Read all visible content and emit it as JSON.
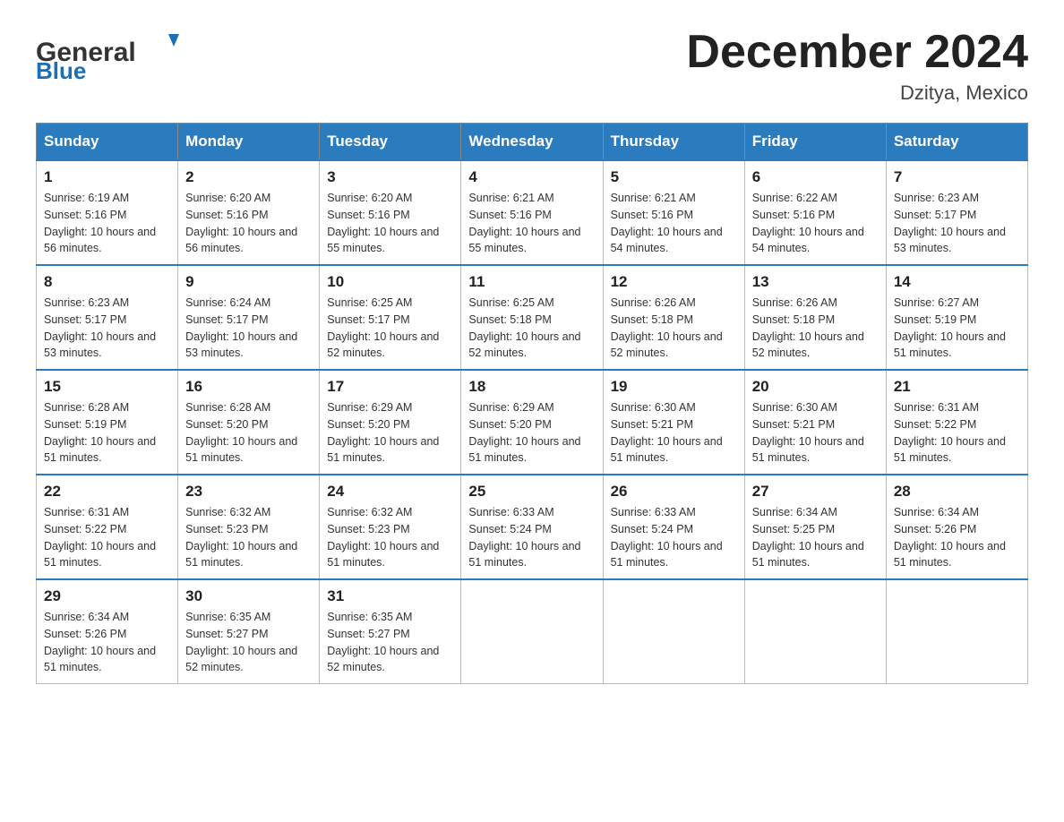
{
  "header": {
    "logo": {
      "text_general": "General",
      "text_blue": "Blue",
      "triangle_color": "#1a6fb5"
    },
    "title": "December 2024",
    "subtitle": "Dzitya, Mexico"
  },
  "days_of_week": [
    "Sunday",
    "Monday",
    "Tuesday",
    "Wednesday",
    "Thursday",
    "Friday",
    "Saturday"
  ],
  "weeks": [
    [
      {
        "day": 1,
        "sunrise": "6:19 AM",
        "sunset": "5:16 PM",
        "daylight": "10 hours and 56 minutes."
      },
      {
        "day": 2,
        "sunrise": "6:20 AM",
        "sunset": "5:16 PM",
        "daylight": "10 hours and 56 minutes."
      },
      {
        "day": 3,
        "sunrise": "6:20 AM",
        "sunset": "5:16 PM",
        "daylight": "10 hours and 55 minutes."
      },
      {
        "day": 4,
        "sunrise": "6:21 AM",
        "sunset": "5:16 PM",
        "daylight": "10 hours and 55 minutes."
      },
      {
        "day": 5,
        "sunrise": "6:21 AM",
        "sunset": "5:16 PM",
        "daylight": "10 hours and 54 minutes."
      },
      {
        "day": 6,
        "sunrise": "6:22 AM",
        "sunset": "5:16 PM",
        "daylight": "10 hours and 54 minutes."
      },
      {
        "day": 7,
        "sunrise": "6:23 AM",
        "sunset": "5:17 PM",
        "daylight": "10 hours and 53 minutes."
      }
    ],
    [
      {
        "day": 8,
        "sunrise": "6:23 AM",
        "sunset": "5:17 PM",
        "daylight": "10 hours and 53 minutes."
      },
      {
        "day": 9,
        "sunrise": "6:24 AM",
        "sunset": "5:17 PM",
        "daylight": "10 hours and 53 minutes."
      },
      {
        "day": 10,
        "sunrise": "6:25 AM",
        "sunset": "5:17 PM",
        "daylight": "10 hours and 52 minutes."
      },
      {
        "day": 11,
        "sunrise": "6:25 AM",
        "sunset": "5:18 PM",
        "daylight": "10 hours and 52 minutes."
      },
      {
        "day": 12,
        "sunrise": "6:26 AM",
        "sunset": "5:18 PM",
        "daylight": "10 hours and 52 minutes."
      },
      {
        "day": 13,
        "sunrise": "6:26 AM",
        "sunset": "5:18 PM",
        "daylight": "10 hours and 52 minutes."
      },
      {
        "day": 14,
        "sunrise": "6:27 AM",
        "sunset": "5:19 PM",
        "daylight": "10 hours and 51 minutes."
      }
    ],
    [
      {
        "day": 15,
        "sunrise": "6:28 AM",
        "sunset": "5:19 PM",
        "daylight": "10 hours and 51 minutes."
      },
      {
        "day": 16,
        "sunrise": "6:28 AM",
        "sunset": "5:20 PM",
        "daylight": "10 hours and 51 minutes."
      },
      {
        "day": 17,
        "sunrise": "6:29 AM",
        "sunset": "5:20 PM",
        "daylight": "10 hours and 51 minutes."
      },
      {
        "day": 18,
        "sunrise": "6:29 AM",
        "sunset": "5:20 PM",
        "daylight": "10 hours and 51 minutes."
      },
      {
        "day": 19,
        "sunrise": "6:30 AM",
        "sunset": "5:21 PM",
        "daylight": "10 hours and 51 minutes."
      },
      {
        "day": 20,
        "sunrise": "6:30 AM",
        "sunset": "5:21 PM",
        "daylight": "10 hours and 51 minutes."
      },
      {
        "day": 21,
        "sunrise": "6:31 AM",
        "sunset": "5:22 PM",
        "daylight": "10 hours and 51 minutes."
      }
    ],
    [
      {
        "day": 22,
        "sunrise": "6:31 AM",
        "sunset": "5:22 PM",
        "daylight": "10 hours and 51 minutes."
      },
      {
        "day": 23,
        "sunrise": "6:32 AM",
        "sunset": "5:23 PM",
        "daylight": "10 hours and 51 minutes."
      },
      {
        "day": 24,
        "sunrise": "6:32 AM",
        "sunset": "5:23 PM",
        "daylight": "10 hours and 51 minutes."
      },
      {
        "day": 25,
        "sunrise": "6:33 AM",
        "sunset": "5:24 PM",
        "daylight": "10 hours and 51 minutes."
      },
      {
        "day": 26,
        "sunrise": "6:33 AM",
        "sunset": "5:24 PM",
        "daylight": "10 hours and 51 minutes."
      },
      {
        "day": 27,
        "sunrise": "6:34 AM",
        "sunset": "5:25 PM",
        "daylight": "10 hours and 51 minutes."
      },
      {
        "day": 28,
        "sunrise": "6:34 AM",
        "sunset": "5:26 PM",
        "daylight": "10 hours and 51 minutes."
      }
    ],
    [
      {
        "day": 29,
        "sunrise": "6:34 AM",
        "sunset": "5:26 PM",
        "daylight": "10 hours and 51 minutes."
      },
      {
        "day": 30,
        "sunrise": "6:35 AM",
        "sunset": "5:27 PM",
        "daylight": "10 hours and 52 minutes."
      },
      {
        "day": 31,
        "sunrise": "6:35 AM",
        "sunset": "5:27 PM",
        "daylight": "10 hours and 52 minutes."
      },
      null,
      null,
      null,
      null
    ]
  ]
}
